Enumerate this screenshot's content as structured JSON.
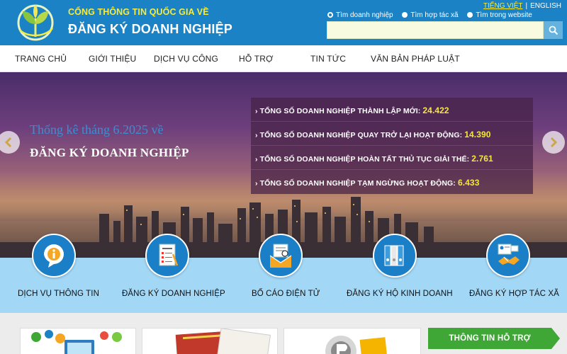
{
  "header": {
    "portal_subtitle": "CỔNG THÔNG TIN QUỐC GIA VỀ",
    "portal_title": "ĐĂNG KÝ DOANH NGHIỆP",
    "lang_vi": "TIẾNG VIỆT",
    "lang_en": "ENGLISH",
    "search_options": [
      {
        "label": "Tìm doanh nghiệp",
        "selected": true
      },
      {
        "label": "Tìm hợp tác xã",
        "selected": false
      },
      {
        "label": "Tìm trong website",
        "selected": false
      }
    ],
    "search_value": "",
    "search_placeholder": ""
  },
  "nav": {
    "items": [
      "TRANG CHỦ",
      "GIỚI THIỆU",
      "DỊCH VỤ CÔNG",
      "HỖ TRỢ",
      "TIN TỨC",
      "VĂN BẢN PHÁP LUẬT"
    ]
  },
  "hero": {
    "period": "Thống kê tháng 6.2025 về",
    "title": "ĐĂNG KÝ DOANH NGHIỆP",
    "stats": [
      {
        "label": "› TỔNG SỐ DOANH NGHIỆP THÀNH LẬP MỚI:",
        "value": "24.422"
      },
      {
        "label": "› TỔNG SỐ DOANH NGHIỆP QUAY TRỞ LẠI HOẠT ĐỘNG:",
        "value": "14.390"
      },
      {
        "label": "› TỔNG SỐ DOANH NGHIỆP HOÀN TẤT THỦ TỤC GIẢI THỂ:",
        "value": "2.761"
      },
      {
        "label": "› TỔNG SỐ DOANH NGHIỆP TẠM NGỪNG HOẠT ĐỘNG:",
        "value": "6.433"
      }
    ]
  },
  "services": [
    {
      "label": "DỊCH VỤ THÔNG TIN",
      "icon": "info-icon"
    },
    {
      "label": "ĐĂNG KÝ DOANH NGHIỆP",
      "icon": "document-form-icon"
    },
    {
      "label": "BỐ CÁO ĐIỆN TỬ",
      "icon": "email-announcement-icon"
    },
    {
      "label": "ĐĂNG KÝ HỘ KINH DOANH",
      "icon": "binders-icon"
    },
    {
      "label": "ĐĂNG KÝ HỢP TÁC XÃ",
      "icon": "handshake-icon"
    }
  ],
  "support": {
    "label": "THÔNG TIN HỖ TRỢ"
  },
  "colors": {
    "header_blue": "#1a82c5",
    "accent_yellow": "#f7ec3e",
    "service_strip": "#a2d7f6",
    "support_green": "#3ea735"
  }
}
